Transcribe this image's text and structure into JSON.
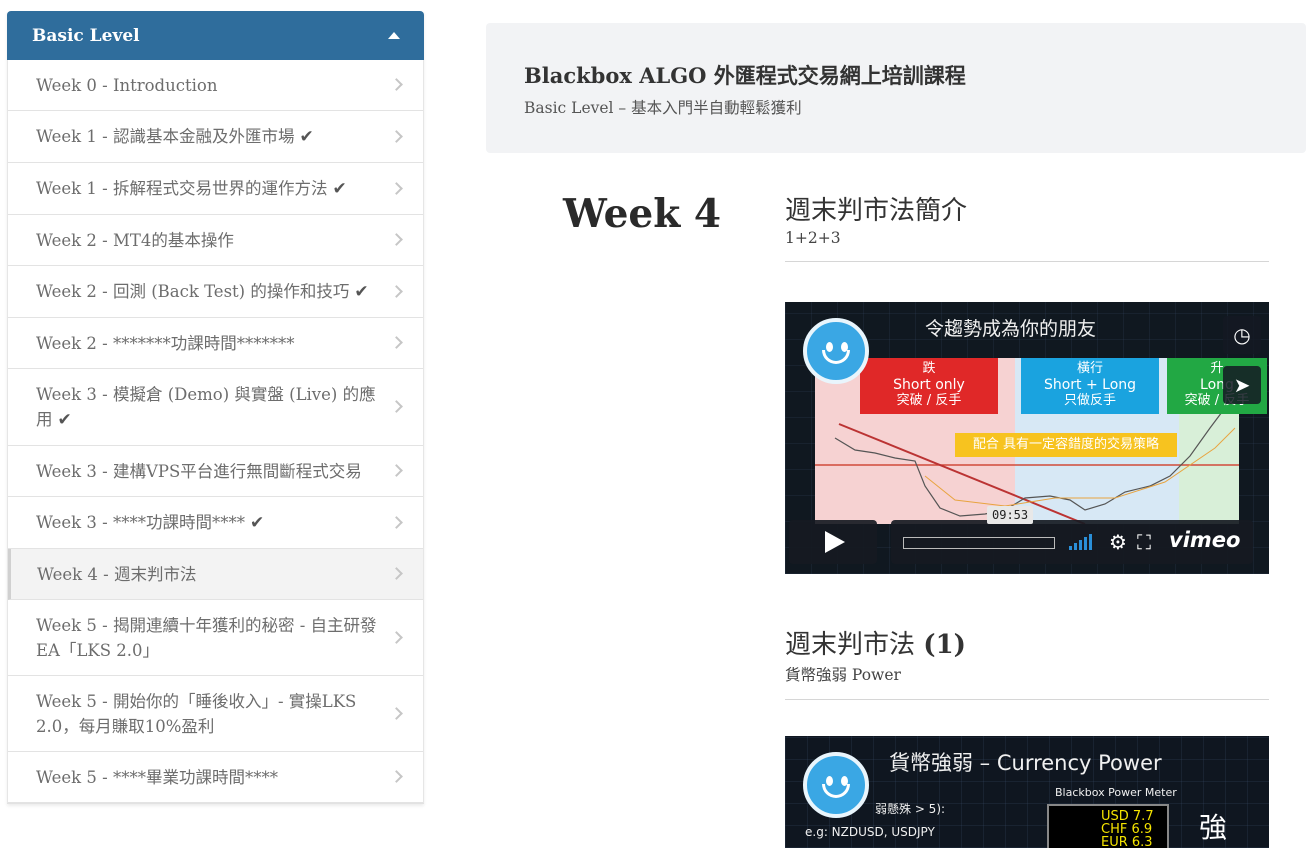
{
  "sidebar": {
    "header": "Basic Level",
    "items": [
      {
        "label": "Week 0 - Introduction",
        "completed": false,
        "active": false
      },
      {
        "label": "Week 1 - 認識基本金融及外匯市場",
        "completed": true,
        "active": false
      },
      {
        "label": "Week 1 - 拆解程式交易世界的運作方法",
        "completed": true,
        "active": false
      },
      {
        "label": "Week 2 - MT4的基本操作",
        "completed": false,
        "active": false
      },
      {
        "label": "Week 2 - 回測 (Back Test) 的操作和技巧",
        "completed": true,
        "active": false
      },
      {
        "label": "Week 2 - *******功課時間*******",
        "completed": false,
        "active": false
      },
      {
        "label": "Week 3 - 模擬倉 (Demo) 與實盤 (Live) 的應用",
        "completed": true,
        "active": false
      },
      {
        "label": "Week 3 - 建構VPS平台進行無間斷程式交易",
        "completed": false,
        "active": false
      },
      {
        "label": "Week 3 - ****功課時間****",
        "completed": true,
        "active": false
      },
      {
        "label": "Week 4 - 週末判市法",
        "completed": false,
        "active": true
      },
      {
        "label": "Week 5 - 揭開連續十年獲利的秘密 - 自主研發EA「LKS 2.0」",
        "completed": false,
        "active": false
      },
      {
        "label": "Week 5 - 開始你的「睡後收入」- 實操LKS 2.0，每月賺取10%盈利",
        "completed": false,
        "active": false
      },
      {
        "label": "Week 5 - ****畢業功課時間****",
        "completed": false,
        "active": false
      }
    ]
  },
  "course": {
    "title": "Blackbox ALGO 外匯程式交易網上培訓課程",
    "subtitle": "Basic Level – 基本入門半自動輕鬆獲利"
  },
  "week": {
    "heading": "Week 4"
  },
  "lessons": [
    {
      "title": "週末判市法簡介",
      "subtitle": "1+2+3",
      "video": {
        "slide_title": "令趨勢成為你的朋友",
        "tags": [
          {
            "line1": "跌",
            "line2": "Short only",
            "line3": "突破 / 反手",
            "color": "#e02828"
          },
          {
            "line1": "橫行",
            "line2": "Short + Long",
            "line3": "只做反手",
            "color": "#1aa3df"
          },
          {
            "line1": "升",
            "line2": "Long",
            "line3": "突破 / 反手",
            "color": "#22a844"
          }
        ],
        "banner": "配合 具有一定容錯度的交易策略",
        "timecode": "09:53",
        "brand": "vimeo",
        "side_icons": [
          "clock-icon",
          "send-icon"
        ]
      }
    },
    {
      "title": "週末判市法 ",
      "title_bold": "(1)",
      "subtitle": "貨幣強弱 Power",
      "video": {
        "slide_title": "貨幣強弱 – Currency Power",
        "text1": "弱懸殊 > 5):",
        "text2": "e.g: NZDUSD, USDJPY",
        "meter_title": "Blackbox Power Meter",
        "meter_rows": [
          "USD  7.7",
          "CHF  6.9",
          "EUR  6.3"
        ],
        "strong_label": "強"
      }
    }
  ]
}
